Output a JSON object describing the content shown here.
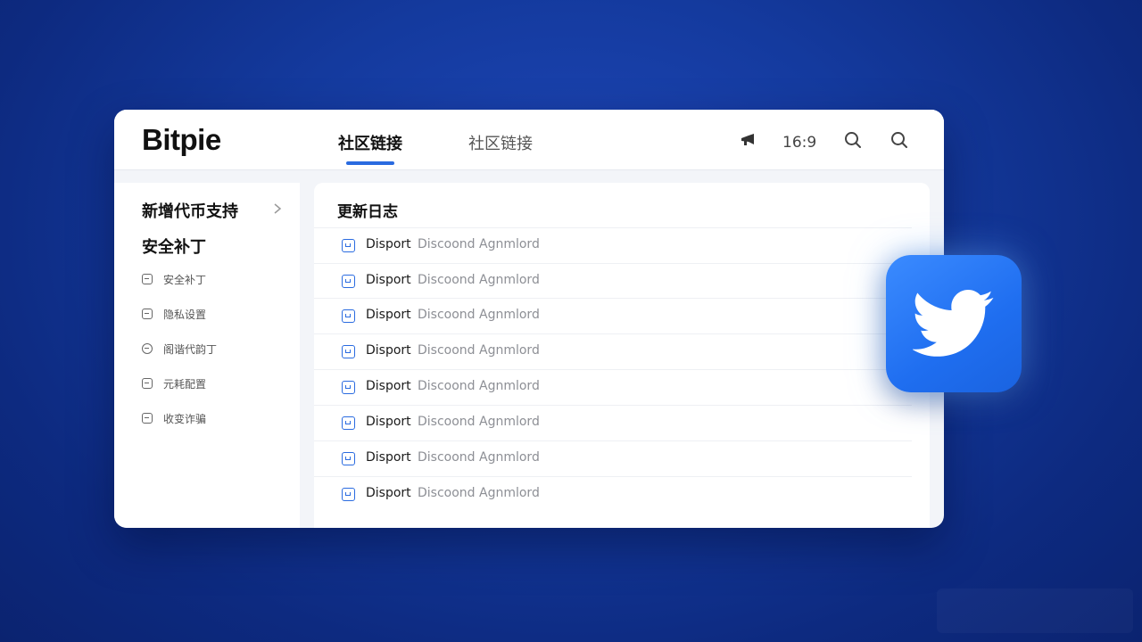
{
  "header": {
    "logo": "Bitpie",
    "tabs": [
      {
        "label": "社区链接",
        "active": true
      },
      {
        "label": "社区链接",
        "active": false
      }
    ],
    "aspect_label": "16:9",
    "icons": [
      "megaphone-icon",
      "search-icon",
      "search-icon"
    ]
  },
  "sidebar": {
    "section1": "新增代币支持",
    "section2": "安全补丁",
    "items": [
      {
        "label": "安全补丁",
        "icon": "square-icon"
      },
      {
        "label": "隐私设置",
        "icon": "square-icon"
      },
      {
        "label": "阁谐代韵丁",
        "icon": "circle-icon"
      },
      {
        "label": "元耗配置",
        "icon": "square-icon"
      },
      {
        "label": "收变诈骗",
        "icon": "square-icon"
      }
    ]
  },
  "main": {
    "title": "更新日志",
    "rows": [
      {
        "strong": "Disport",
        "muted": "Discoond Agnmlord"
      },
      {
        "strong": "Disport",
        "muted": "Discoond Agnmlord"
      },
      {
        "strong": "Disport",
        "muted": "Discoond Agnmlord"
      },
      {
        "strong": "Disport",
        "muted": "Discoond Agnmlord"
      },
      {
        "strong": "Disport",
        "muted": "Discoond Agnmlord"
      },
      {
        "strong": "Disport",
        "muted": "Discoond Agnmlord"
      },
      {
        "strong": "Disport",
        "muted": "Discoond Agnmlord"
      },
      {
        "strong": "Disport",
        "muted": "Discoond Agnmlord"
      }
    ]
  },
  "colors": {
    "accent": "#2a6be0",
    "background": "#143a9e",
    "twitter": "#1f6ef0"
  },
  "badge": {
    "icon": "twitter-bird-icon"
  }
}
